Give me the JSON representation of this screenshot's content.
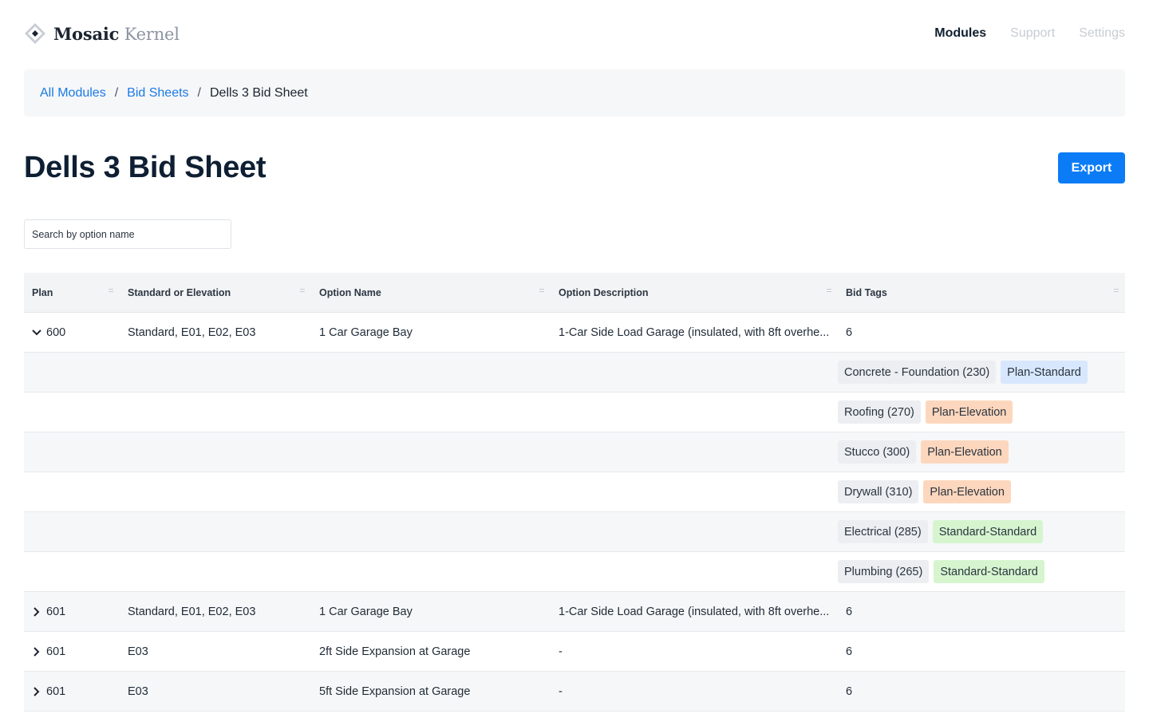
{
  "brand": {
    "name_bold": "Mosaic",
    "name_light": "Kernel"
  },
  "nav": [
    {
      "label": "Modules",
      "active": true
    },
    {
      "label": "Support",
      "active": false
    },
    {
      "label": "Settings",
      "active": false
    }
  ],
  "breadcrumb": {
    "items": [
      "All Modules",
      "Bid Sheets"
    ],
    "separator": "/",
    "current": "Dells 3 Bid Sheet"
  },
  "page": {
    "title": "Dells 3 Bid Sheet",
    "export_label": "Export"
  },
  "search": {
    "placeholder": "Search by option name",
    "value": ""
  },
  "table": {
    "columns": [
      "Plan",
      "Standard or Elevation",
      "Option Name",
      "Option Description",
      "Bid Tags"
    ],
    "rows": [
      {
        "plan": "600",
        "std": "Standard, E01, E02, E03",
        "option": "1 Car Garage Bay",
        "desc": "1-Car Side Load Garage (insulated, with 8ft overhe...",
        "tags": "6",
        "expanded": true
      },
      {
        "plan": "601",
        "std": "Standard, E01, E02, E03",
        "option": "1 Car Garage Bay",
        "desc": "1-Car Side Load Garage (insulated, with 8ft overhe...",
        "tags": "6",
        "expanded": false
      },
      {
        "plan": "601",
        "std": "E03",
        "option": "2ft Side Expansion at Garage",
        "desc": "-",
        "tags": "6",
        "expanded": false
      },
      {
        "plan": "601",
        "std": "E03",
        "option": "5ft Side Expansion at Garage",
        "desc": "-",
        "tags": "6",
        "expanded": false
      }
    ],
    "expanded_tags": [
      {
        "trade": "Concrete - Foundation (230)",
        "type": "Plan-Standard"
      },
      {
        "trade": "Roofing (270)",
        "type": "Plan-Elevation"
      },
      {
        "trade": "Stucco (300)",
        "type": "Plan-Elevation"
      },
      {
        "trade": "Drywall (310)",
        "type": "Plan-Elevation"
      },
      {
        "trade": "Electrical (285)",
        "type": "Standard-Standard"
      },
      {
        "trade": "Plumbing (265)",
        "type": "Standard-Standard"
      }
    ]
  },
  "colors": {
    "accent": "#0b7cf6",
    "link": "#1a7ae6",
    "plan_standard": "#d7e7fd",
    "plan_elevation": "#fdd7bd",
    "standard_standard": "#d6f5cf"
  }
}
